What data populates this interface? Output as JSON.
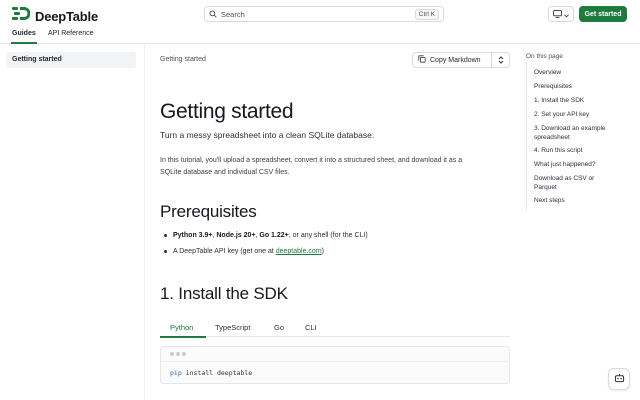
{
  "brand": {
    "name": "DeepTable",
    "accent": "#1f7a3d"
  },
  "header": {
    "search_placeholder": "Search",
    "search_shortcut": "Ctrl K",
    "theme_icon": "monitor-icon",
    "get_started_label": "Get started"
  },
  "subnav": {
    "tabs": [
      {
        "label": "Guides"
      },
      {
        "label": "API Reference"
      }
    ]
  },
  "sidebar": {
    "items": [
      {
        "label": "Getting started"
      }
    ]
  },
  "main": {
    "breadcrumb": "Getting started",
    "copy_markdown_label": "Copy Markdown",
    "title": "Getting started",
    "lead": "Turn a messy spreadsheet into a clean SQLite database.",
    "intro_line1": "In this tutorial, you'll upload a spreadsheet, convert it into a structured sheet, and download it as a",
    "intro_line2": "SQLite database and individual CSV files.",
    "prerequisites": {
      "heading": "Prerequisites",
      "item1": {
        "b1": "Python 3.9+",
        "s1": ", ",
        "b2": "Node.js 20+",
        "s2": ", ",
        "b3": "Go 1.22+",
        "rest": ", or any shell (for the CLI)"
      },
      "item2": {
        "text": "A DeepTable API key (get one at ",
        "link": "deeptable.com",
        "end": ")"
      }
    },
    "install": {
      "heading": "1. Install the SDK",
      "tabs": [
        {
          "label": "Python"
        },
        {
          "label": "TypeScript"
        },
        {
          "label": "Go"
        },
        {
          "label": "CLI"
        }
      ],
      "active_tab": "Python",
      "code": {
        "cmd": "pip",
        "args": " install deeptable"
      }
    }
  },
  "toc": {
    "title": "On this page",
    "items": [
      {
        "label": "Overview"
      },
      {
        "label": "Prerequisites"
      },
      {
        "label": "1. Install the SDK"
      },
      {
        "label": "2. Set your API key"
      },
      {
        "label": "3. Download an example spreadsheet"
      },
      {
        "label": "4. Run this script"
      },
      {
        "label": "What just happened?"
      },
      {
        "label": "Download as CSV or Parquet"
      },
      {
        "label": "Next steps"
      }
    ]
  }
}
